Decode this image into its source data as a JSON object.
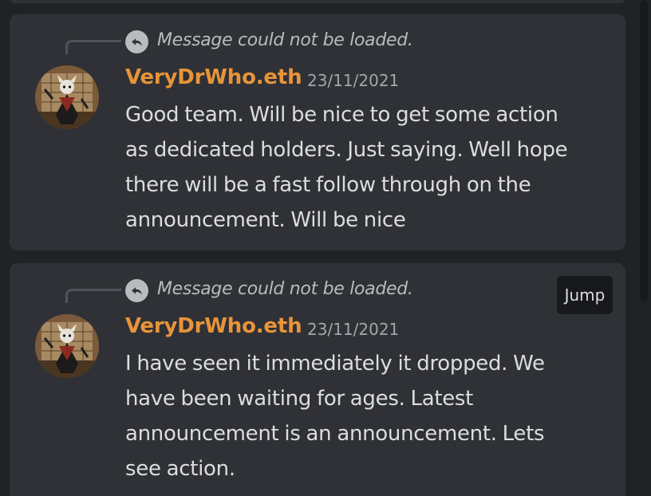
{
  "colors": {
    "background": "#202225",
    "message_bg": "#2f3136",
    "username": "#e8943a",
    "text": "#dcddde",
    "muted": "#b9bbbe",
    "jump_bg": "#18191c"
  },
  "messages": [
    {
      "reply_preview": "Message could not be loaded.",
      "reply_icon": "reply-arrow-icon",
      "username": "VeryDrWho.eth",
      "timestamp": "23/11/2021",
      "lines": [
        "Good team. Will be nice to get some action",
        "as dedicated holders. Just saying. Well hope",
        "there will be a fast follow through on the",
        "announcement. Will be nice"
      ]
    },
    {
      "reply_preview": "Message could not be loaded.",
      "reply_icon": "reply-arrow-icon",
      "username": "VeryDrWho.eth",
      "timestamp": "23/11/2021",
      "jump_label": "Jump",
      "lines": [
        "I have seen it immediately it dropped. We",
        "have been waiting for ages. Latest",
        "announcement is an announcement. Lets",
        "see action."
      ]
    }
  ]
}
